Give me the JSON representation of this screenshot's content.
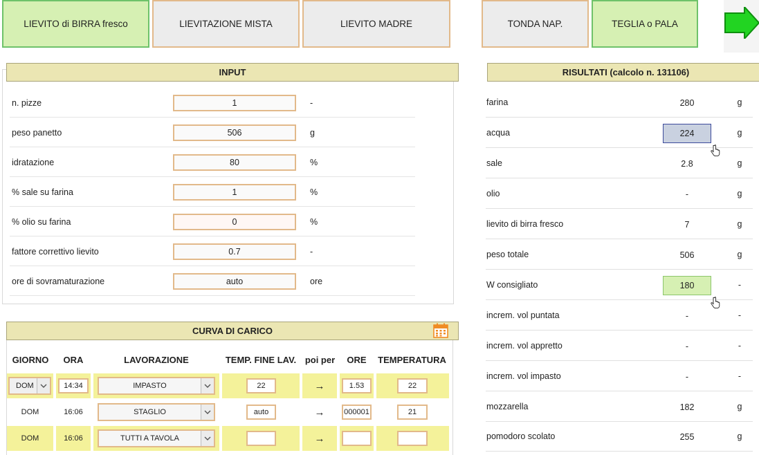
{
  "tabs": [
    "LIEVITO di BIRRA fresco",
    "LIEVITAZIONE MISTA",
    "LIEVITO MADRE",
    "TONDA NAP.",
    "TEGLIA o PALA"
  ],
  "input": {
    "title": "INPUT",
    "rows": [
      {
        "label": "n. pizze",
        "value": "1",
        "unit": "-"
      },
      {
        "label": "peso panetto",
        "value": "506",
        "unit": "g"
      },
      {
        "label": "idratazione",
        "value": "80",
        "unit": "%"
      },
      {
        "label": "% sale su farina",
        "value": "1",
        "unit": "%"
      },
      {
        "label": "% olio su farina",
        "value": "0",
        "unit": "%"
      },
      {
        "label": "fattore correttivo lievito",
        "value": "0.7",
        "unit": "-"
      },
      {
        "label": "ore di sovramaturazione",
        "value": "auto",
        "unit": "ore"
      }
    ]
  },
  "results": {
    "title": "RISULTATI (calcolo n. 131106)",
    "rows": [
      {
        "label": "farina",
        "value": "280",
        "unit": "g"
      },
      {
        "label": "acqua",
        "value": "224",
        "unit": "g"
      },
      {
        "label": "sale",
        "value": "2.8",
        "unit": "g"
      },
      {
        "label": "olio",
        "value": "-",
        "unit": "g"
      },
      {
        "label": "lievito di birra fresco",
        "value": "7",
        "unit": "g"
      },
      {
        "label": "peso totale",
        "value": "506",
        "unit": "g"
      },
      {
        "label": "W consigliato",
        "value": "180",
        "unit": "-"
      },
      {
        "label": "increm. vol puntata",
        "value": "-",
        "unit": "-"
      },
      {
        "label": "increm. vol appretto",
        "value": "-",
        "unit": "-"
      },
      {
        "label": "increm. vol impasto",
        "value": "-",
        "unit": "-"
      },
      {
        "label": "mozzarella",
        "value": "182",
        "unit": "g"
      },
      {
        "label": "pomodoro scolato",
        "value": "255",
        "unit": "g"
      }
    ]
  },
  "curve": {
    "title": "CURVA DI CARICO",
    "headers": [
      "GIORNO",
      "ORA",
      "LAVORAZIONE",
      "TEMP. FINE LAV.",
      "poi per",
      "ORE",
      "TEMPERATURA"
    ],
    "rows": [
      {
        "giorno": "DOM",
        "ora": "14:34",
        "lavorazione": "IMPASTO",
        "temp_fine": "22",
        "arrow": "→",
        "ore": "1.53",
        "temperatura": "22"
      },
      {
        "giorno": "DOM",
        "ora": "16:06",
        "lavorazione": "STAGLIO",
        "temp_fine": "auto",
        "arrow": "→",
        "ore": "000001",
        "temperatura": "21"
      },
      {
        "giorno": "DOM",
        "ora": "16:06",
        "lavorazione": "TUTTI A TAVOLA",
        "temp_fine": "",
        "arrow": "→",
        "ore": "",
        "temperatura": ""
      }
    ]
  },
  "colors": {
    "accent_green": "#d6f0b3",
    "header_bg": "#ebe6b3",
    "row_yellow": "#f4f29a",
    "border_orange": "#e2b98a",
    "highlight_blue": "#c9d1e0"
  },
  "icons": {
    "calendar": "calendar-icon",
    "next": "arrow-right-icon",
    "cursor": "hand-pointer-icon"
  }
}
